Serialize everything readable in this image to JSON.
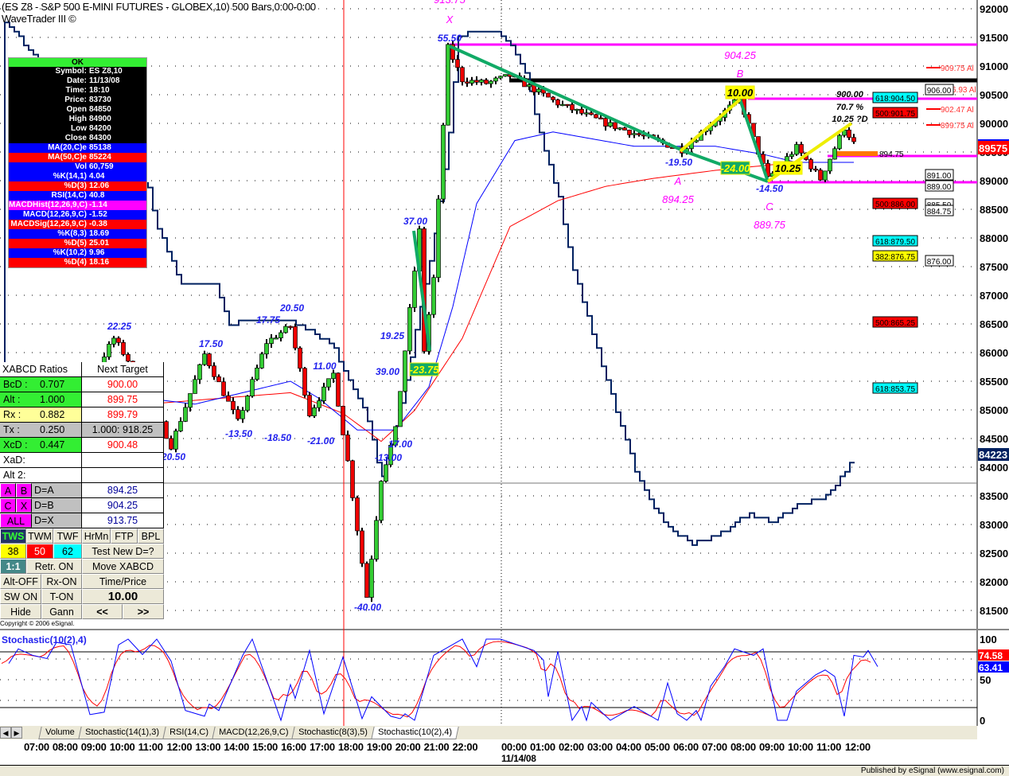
{
  "header": {
    "title": "(ES Z8 - S&P 500 E-MINI FUTURES - GLOBEX,10) 500 Bars,0:00-0:00",
    "subtitle": "WaveTrader III ©"
  },
  "info_panel": {
    "status": "OK",
    "rows": [
      {
        "k": "Symbol:",
        "v": "ES Z8,10",
        "bg": "#000000"
      },
      {
        "k": "Date:",
        "v": "11/13/08",
        "bg": "#000000"
      },
      {
        "k": "Time:",
        "v": "18:10",
        "bg": "#000000"
      },
      {
        "k": "Price:",
        "v": "83730",
        "bg": "#000000"
      },
      {
        "k": "Open",
        "v": "84850",
        "bg": "#000000"
      },
      {
        "k": "High",
        "v": "84900",
        "bg": "#000000"
      },
      {
        "k": "Low",
        "v": "84200",
        "bg": "#000000"
      },
      {
        "k": "Close",
        "v": "84300",
        "bg": "#000000"
      },
      {
        "k": "MA(20,C)e",
        "v": "85138",
        "bg": "#0000ff"
      },
      {
        "k": "MA(50,C)e",
        "v": "85224",
        "bg": "#ff0000"
      },
      {
        "k": "Vol",
        "v": "60,759",
        "bg": "#0000ff"
      },
      {
        "k": "%K(14,1)",
        "v": "4.04",
        "bg": "#0000ff"
      },
      {
        "k": "%D(3)",
        "v": "12.06",
        "bg": "#ff0000"
      },
      {
        "k": "RSI(14,C)",
        "v": "40.8",
        "bg": "#0000ff"
      },
      {
        "k": "MACDHist(12,26,9,C)",
        "v": "-1.14",
        "bg": "#ff00ff"
      },
      {
        "k": "MACD(12,26,9,C)",
        "v": "-1.52",
        "bg": "#0000ff"
      },
      {
        "k": "MACDSig(12,26,9,C)",
        "v": "-0.38",
        "bg": "#ff0000"
      },
      {
        "k": "%K(8,3)",
        "v": "18.69",
        "bg": "#0000ff"
      },
      {
        "k": "%D(5)",
        "v": "25.01",
        "bg": "#ff0000"
      },
      {
        "k": "%K(10,2)",
        "v": "9.96",
        "bg": "#0000ff"
      },
      {
        "k": "%D(4)",
        "v": "18.16",
        "bg": "#ff0000"
      }
    ]
  },
  "xabcd": {
    "title": "XABCD Ratios",
    "next_target": "Next Target",
    "ratios": [
      {
        "k": "BcD :",
        "v": "0.707",
        "t": "900.00",
        "bg": "#33ee33"
      },
      {
        "k": "Alt  :",
        "v": "1.000",
        "t": "899.75",
        "bg": "#33ee33"
      },
      {
        "k": "Rx  :",
        "v": "0.882",
        "t": "899.79",
        "bg": "#ffff99"
      },
      {
        "k": "Tx  :",
        "v": "0.250",
        "t": "1.000: 918.25",
        "bg": "#c0c0c0"
      },
      {
        "k": "XcD :",
        "v": "0.447",
        "t": "900.48",
        "bg": "#33ee33"
      },
      {
        "k": "XaD:",
        "v": "",
        "t": "",
        "bg": "#ffffff"
      },
      {
        "k": "Alt 2:",
        "v": "",
        "t": "",
        "bg": "#ffffff"
      }
    ],
    "points": [
      {
        "a": "A",
        "b": "B",
        "d": "D=A",
        "v": "894.25"
      },
      {
        "a": "C",
        "b": "X",
        "d": "D=B",
        "v": "904.25"
      },
      {
        "a": "ALL",
        "b": "",
        "d": "D=X",
        "v": "913.75"
      }
    ],
    "buttons": {
      "row1": [
        "TWS",
        "TWM",
        "TWF",
        "HrMn",
        "FTP",
        "BPL"
      ],
      "fib": [
        "38",
        "50",
        "62"
      ],
      "test": "Test New D=?",
      "one": "1:1",
      "retr": "Retr. ON",
      "move": "Move XABCD",
      "alt": "Alt-OFF",
      "rx": "Rx-ON",
      "tp": "Time/Price",
      "sw": "SW ON",
      "ton": "T-ON",
      "value": "10.00",
      "hide": "Hide",
      "gann": "Gann",
      "prev": "<<",
      "next": ">>"
    },
    "copyright": "Copyright © 2006 eSignal."
  },
  "price_axis": {
    "labels": [
      "92000",
      "91500",
      "91000",
      "90500",
      "90000",
      "89500",
      "89000",
      "88500",
      "88000",
      "87500",
      "87000",
      "86500",
      "86000",
      "85500",
      "85000",
      "84500",
      "84000",
      "83500",
      "83000",
      "82500",
      "82000",
      "81500"
    ],
    "last_price": "89575",
    "osc_value": "84223"
  },
  "chart_data": {
    "type": "candlestick",
    "price_path": [
      [
        0,
        84650
      ],
      [
        6,
        85200
      ],
      [
        14,
        84930
      ],
      [
        23,
        86250
      ],
      [
        29,
        85490
      ],
      [
        35,
        84375
      ],
      [
        42,
        85970
      ],
      [
        49,
        84790
      ],
      [
        55,
        86180
      ],
      [
        60,
        86460
      ],
      [
        64,
        84930
      ],
      [
        69,
        85630
      ],
      [
        72,
        84100
      ],
      [
        76,
        81740
      ],
      [
        79,
        83800
      ],
      [
        82,
        84650
      ],
      [
        87,
        88125
      ],
      [
        88,
        86040
      ],
      [
        90,
        87290
      ],
      [
        93,
        91320
      ],
      [
        96,
        90760
      ],
      [
        101,
        90700
      ],
      [
        106,
        90830
      ],
      [
        116,
        90350
      ],
      [
        126,
        90000
      ],
      [
        142,
        89540
      ],
      [
        154,
        90430
      ],
      [
        160,
        89030
      ],
      [
        166,
        89580
      ],
      [
        171,
        89030
      ],
      [
        176,
        89930
      ],
      [
        178,
        89650
      ]
    ],
    "overlay_line": [
      [
        0,
        91800
      ],
      [
        30,
        88900
      ],
      [
        32,
        88200
      ],
      [
        37,
        87200
      ],
      [
        44,
        87200
      ],
      [
        47,
        86500
      ],
      [
        54,
        86600
      ],
      [
        62,
        86500
      ],
      [
        69,
        86100
      ],
      [
        71,
        85700
      ],
      [
        76,
        84900
      ],
      [
        79,
        83800
      ],
      [
        82,
        84650
      ],
      [
        86,
        86300
      ],
      [
        90,
        87990
      ],
      [
        93,
        89700
      ],
      [
        95,
        91500
      ],
      [
        99,
        91630
      ],
      [
        103,
        91630
      ],
      [
        106,
        91370
      ],
      [
        109,
        90960
      ],
      [
        112,
        89850
      ],
      [
        116,
        88750
      ],
      [
        119,
        87500
      ],
      [
        124,
        86100
      ],
      [
        129,
        84750
      ],
      [
        133,
        83750
      ],
      [
        138,
        83050
      ],
      [
        144,
        82640
      ],
      [
        151,
        82900
      ],
      [
        156,
        83190
      ],
      [
        161,
        83050
      ],
      [
        166,
        83330
      ],
      [
        172,
        83470
      ],
      [
        176,
        83900
      ],
      [
        178,
        84223
      ]
    ],
    "ma20": [
      [
        0,
        85000
      ],
      [
        20,
        85300
      ],
      [
        40,
        85100
      ],
      [
        60,
        85500
      ],
      [
        66,
        85200
      ],
      [
        74,
        84650
      ],
      [
        82,
        84650
      ],
      [
        89,
        85400
      ],
      [
        94,
        86800
      ],
      [
        99,
        88600
      ],
      [
        107,
        89700
      ],
      [
        115,
        89850
      ],
      [
        132,
        89600
      ],
      [
        149,
        89600
      ],
      [
        159,
        89460
      ],
      [
        166,
        89320
      ],
      [
        178,
        89320
      ]
    ],
    "ma50": [
      [
        0,
        84900
      ],
      [
        30,
        85100
      ],
      [
        60,
        85300
      ],
      [
        71,
        84940
      ],
      [
        79,
        84450
      ],
      [
        86,
        84990
      ],
      [
        96,
        86250
      ],
      [
        106,
        88200
      ],
      [
        116,
        88650
      ],
      [
        126,
        88900
      ],
      [
        136,
        89040
      ],
      [
        149,
        89180
      ],
      [
        166,
        89320
      ],
      [
        178,
        89320
      ]
    ],
    "labels": [
      "22.25",
      "17.50",
      "17.75",
      "20.50",
      "11.00",
      "19.25",
      "37.00",
      "39.00",
      "-13.50",
      "-18.50",
      "-21.00",
      "20.50",
      "17.00",
      "-13.00",
      "-40.00",
      "55.50",
      "-19.50",
      "-14.50"
    ],
    "boxes": [
      "-23.75",
      "10.00",
      "-24.00",
      "10.25"
    ],
    "pattern_labels": {
      "x_price": "913.75",
      "x": "X",
      "b_price": "904.25",
      "b": "B",
      "a": "A",
      "a_price": "894.25",
      "c": "C",
      "c_price": "889.75",
      "target": "900.00",
      "ratio": "70.7 %",
      "d_note": "10.25 ?D"
    },
    "levels": [
      "618:904.50",
      "500:901.75",
      "500:886.00",
      "618:879.50",
      "382:876.75",
      "500:865.25",
      "618:853.75"
    ],
    "level_colors": [
      "#00ffff",
      "#ff0000",
      "#ff0000",
      "#00ffff",
      "#ffff00",
      "#ff0000",
      "#00ffff"
    ],
    "alt_targets": [
      "909.75 Al",
      "6.93 Al",
      "902.47 Al",
      "899.75 Al"
    ],
    "boxed_prices": [
      "906.00",
      "891.00",
      "889.00",
      "885.50",
      "884.75",
      "876.00"
    ],
    "d_level": "894.75"
  },
  "stochastic": {
    "title": "Stochastic(10(2),4)",
    "axis": [
      "100",
      "50",
      "0"
    ],
    "k_value": "63.41",
    "d_value": "74.58",
    "k": [
      [
        1,
        70
      ],
      [
        3,
        88
      ],
      [
        6,
        80
      ],
      [
        9,
        76
      ],
      [
        11,
        96
      ],
      [
        14,
        93
      ],
      [
        18,
        7
      ],
      [
        21,
        10
      ],
      [
        24,
        93
      ],
      [
        26,
        100
      ],
      [
        29,
        81
      ],
      [
        32,
        100
      ],
      [
        35,
        73
      ],
      [
        38,
        12
      ],
      [
        42,
        5
      ],
      [
        43,
        20
      ],
      [
        45,
        12
      ],
      [
        50,
        80
      ],
      [
        52,
        100
      ],
      [
        58,
        0
      ],
      [
        60,
        44
      ],
      [
        61,
        27
      ],
      [
        64,
        86
      ],
      [
        67,
        8
      ],
      [
        71,
        78
      ],
      [
        75,
        2
      ],
      [
        77,
        29
      ],
      [
        81,
        5
      ],
      [
        83,
        2
      ],
      [
        84,
        8
      ],
      [
        86,
        0
      ],
      [
        90,
        80
      ],
      [
        96,
        100
      ],
      [
        99,
        66
      ],
      [
        101,
        100
      ],
      [
        104,
        100
      ],
      [
        111,
        86
      ],
      [
        113,
        74
      ],
      [
        114,
        29
      ],
      [
        116,
        85
      ],
      [
        119,
        0
      ],
      [
        121,
        17
      ],
      [
        122,
        0
      ],
      [
        123,
        22
      ],
      [
        127,
        0
      ],
      [
        132,
        17
      ],
      [
        137,
        0
      ],
      [
        139,
        46
      ],
      [
        141,
        8
      ],
      [
        143,
        0
      ],
      [
        145,
        12
      ],
      [
        146,
        0
      ],
      [
        148,
        42
      ],
      [
        151,
        67
      ],
      [
        153,
        88
      ],
      [
        157,
        80
      ],
      [
        159,
        88
      ],
      [
        162,
        0
      ],
      [
        164,
        0
      ],
      [
        166,
        36
      ],
      [
        170,
        56
      ],
      [
        172,
        62
      ],
      [
        174,
        54
      ],
      [
        176,
        5
      ],
      [
        178,
        80
      ],
      [
        180,
        78
      ],
      [
        181,
        86
      ],
      [
        183,
        66
      ]
    ]
  },
  "tabs": [
    "Volume",
    "Stochastic(14(1),3)",
    "RSI(14,C)",
    "MACD(12,26,9,C)",
    "Stochastic(8(3),5)",
    "Stochastic(10(2),4)"
  ],
  "time_axis": {
    "day1": [
      "07:00",
      "08:00",
      "09:00",
      "10:00",
      "11:00",
      "12:00",
      "13:00",
      "14:00",
      "15:00",
      "16:00",
      "17:00",
      "18:00",
      "19:00",
      "20:00",
      "21:00",
      "22:00"
    ],
    "day2": [
      "00:00",
      "01:00",
      "02:00",
      "03:00",
      "04:00",
      "05:00",
      "06:00",
      "07:00",
      "08:00",
      "09:00",
      "10:00",
      "11:00",
      "12:00"
    ],
    "date": "11/14/08"
  },
  "status": "Published by eSignal (www.esignal.com)"
}
